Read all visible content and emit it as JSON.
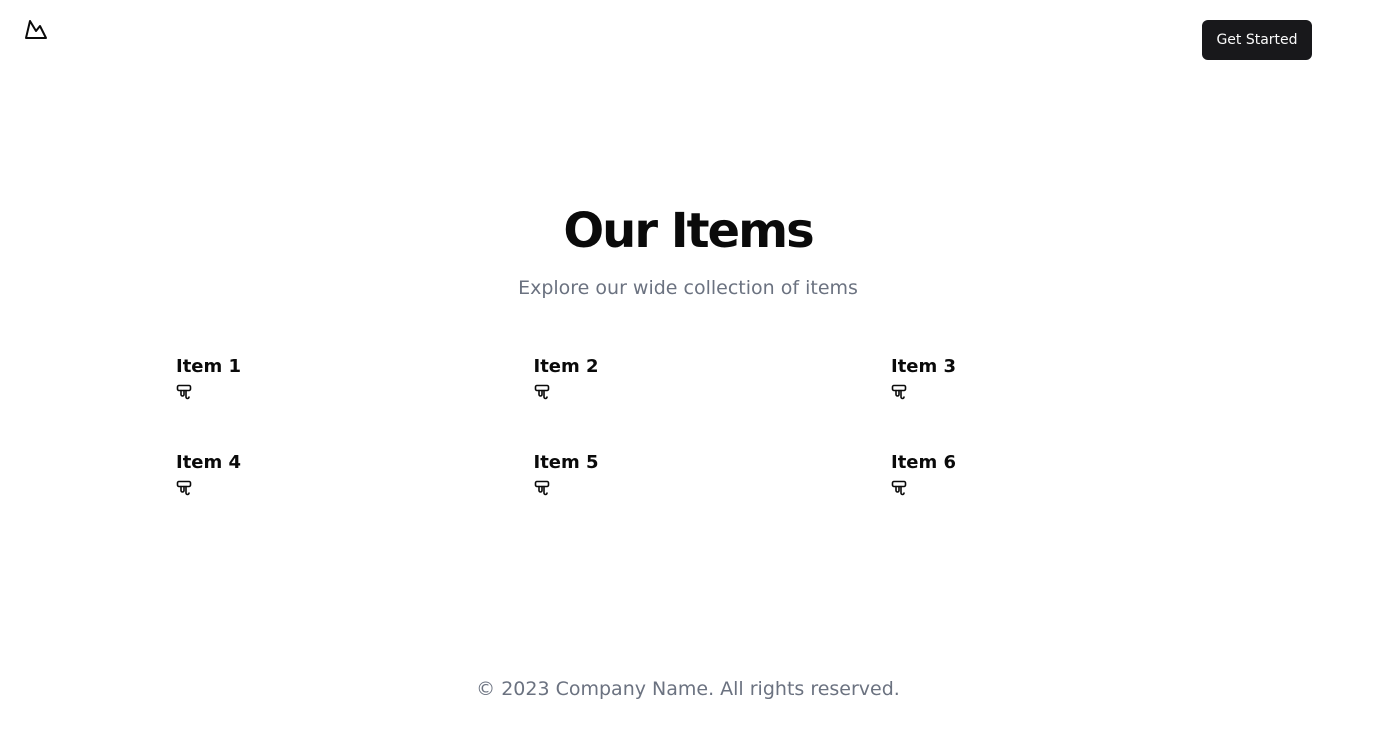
{
  "header": {
    "logo_icon": "mountain-icon",
    "cta_label": "Get Started"
  },
  "hero": {
    "title": "Our Items",
    "subtitle": "Explore our wide collection of items"
  },
  "items": [
    {
      "title": "Item 1",
      "icon": "paint-roller-icon"
    },
    {
      "title": "Item 2",
      "icon": "paint-roller-icon"
    },
    {
      "title": "Item 3",
      "icon": "paint-roller-icon"
    },
    {
      "title": "Item 4",
      "icon": "paint-roller-icon"
    },
    {
      "title": "Item 5",
      "icon": "paint-roller-icon"
    },
    {
      "title": "Item 6",
      "icon": "paint-roller-icon"
    }
  ],
  "footer": {
    "copyright": "© 2023 Company Name. All rights reserved."
  },
  "colors": {
    "primary_button": "#18181b",
    "button_text": "#fafafa",
    "heading": "#0a0a0a",
    "muted_text": "#6b7280"
  }
}
